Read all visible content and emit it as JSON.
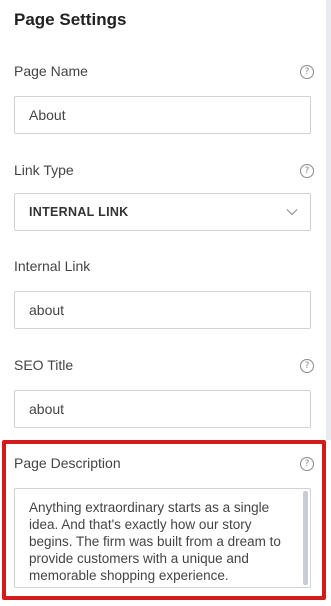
{
  "panel": {
    "title": "Page Settings",
    "help_glyph": "?",
    "fields": {
      "page_name": {
        "label": "Page Name",
        "value": "About"
      },
      "link_type": {
        "label": "Link Type",
        "value": "INTERNAL LINK"
      },
      "internal_link": {
        "label": "Internal Link",
        "value": "about"
      },
      "seo_title": {
        "label": "SEO Title",
        "value": "about"
      },
      "page_description": {
        "label": "Page Description",
        "value": "Anything extraordinary starts as a single idea. And that's exactly how our story begins. The firm was built from a dream to provide customers with a unique and memorable shopping experience."
      }
    }
  },
  "colors": {
    "highlight_border": "#d51a1a",
    "field_border": "#cfd3d8",
    "scrollbar": "#c9ccd8"
  },
  "icons": {
    "help": "question-mark-circle-icon",
    "select": "chevron-down-icon"
  }
}
